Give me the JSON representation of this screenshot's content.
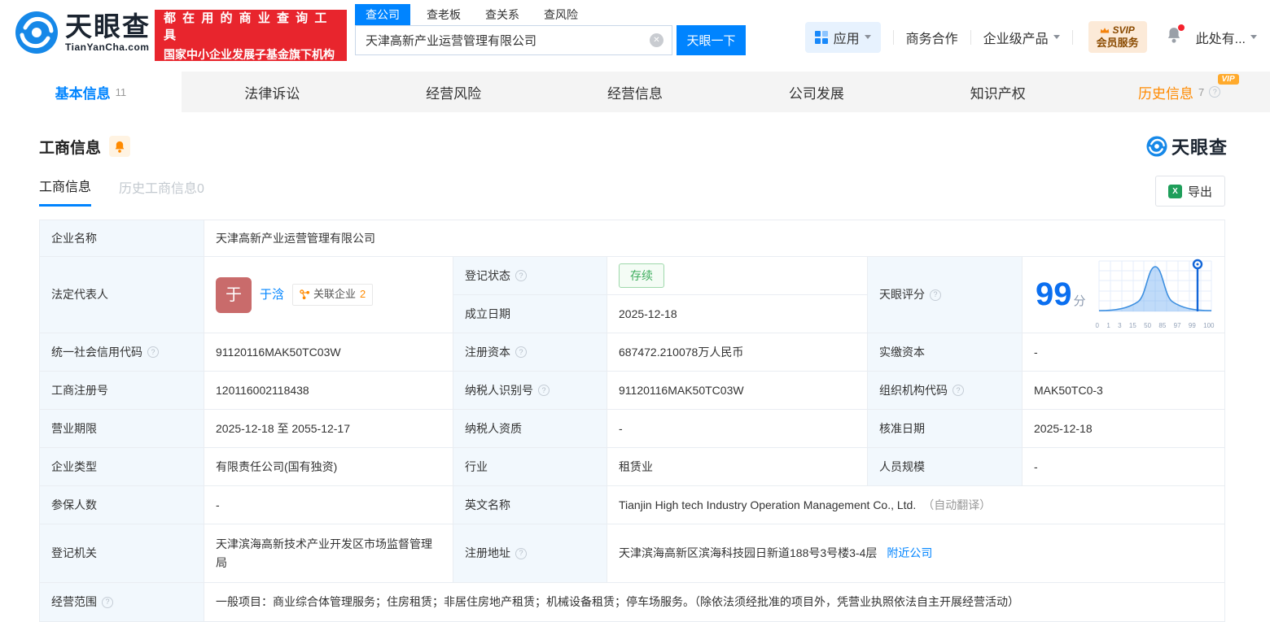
{
  "header": {
    "logo": {
      "brand": "天眼查",
      "domain": "TianYanCha.com"
    },
    "promo": {
      "line1": "都 在 用 的 商 业 查 询 工 具",
      "line2": "国家中小企业发展子基金旗下机构"
    },
    "search": {
      "tabs": [
        {
          "label": "查公司"
        },
        {
          "label": "查老板"
        },
        {
          "label": "查关系"
        },
        {
          "label": "查风险"
        }
      ],
      "value": "天津高新产业运营管理有限公司",
      "button": "天眼一下"
    },
    "nav": {
      "apps": "应用",
      "biz": "商务合作",
      "enterprise": "企业级产品",
      "svip": {
        "line1": "SVIP",
        "line2": "会员服务"
      },
      "user": "此处有..."
    }
  },
  "tabs": [
    {
      "label": "基本信息",
      "count": "11"
    },
    {
      "label": "法律诉讼"
    },
    {
      "label": "经营风险"
    },
    {
      "label": "经营信息"
    },
    {
      "label": "公司发展"
    },
    {
      "label": "知识产权"
    },
    {
      "label": "历史信息",
      "count": "7",
      "vip": "VIP"
    }
  ],
  "section": {
    "title": "工商信息",
    "watermark": "天眼查",
    "subtabs": [
      {
        "label": "工商信息"
      },
      {
        "label": "历史工商信息",
        "count": "0"
      }
    ],
    "export_label": "导出"
  },
  "fields": {
    "company_name": {
      "label": "企业名称",
      "value": "天津高新产业运营管理有限公司"
    },
    "legal_rep": {
      "label": "法定代表人",
      "avatar": "于",
      "name": "于浛",
      "badge": "关联企业",
      "badge_count": "2"
    },
    "reg_status": {
      "label": "登记状态",
      "value": "存续"
    },
    "est_date": {
      "label": "成立日期",
      "value": "2025-12-18"
    },
    "score": {
      "label": "天眼评分",
      "value": "99",
      "unit": "分",
      "axis": [
        "0",
        "1",
        "3",
        "15",
        "50",
        "85",
        "97",
        "99",
        "100"
      ]
    },
    "credit_code": {
      "label": "统一社会信用代码",
      "value": "91120116MAK50TC03W"
    },
    "reg_capital": {
      "label": "注册资本",
      "value": "687472.210078万人民币"
    },
    "paid_capital": {
      "label": "实缴资本",
      "value": "-"
    },
    "reg_number": {
      "label": "工商注册号",
      "value": "120116002118438"
    },
    "taxpayer_id": {
      "label": "纳税人识别号",
      "value": "91120116MAK50TC03W"
    },
    "org_code": {
      "label": "组织机构代码",
      "value": "MAK50TC0-3"
    },
    "biz_term": {
      "label": "营业期限",
      "value": "2025-12-18 至 2055-12-17"
    },
    "taxpayer_quality": {
      "label": "纳税人资质",
      "value": "-"
    },
    "approval_date": {
      "label": "核准日期",
      "value": "2025-12-18"
    },
    "company_type": {
      "label": "企业类型",
      "value": "有限责任公司(国有独资)"
    },
    "industry": {
      "label": "行业",
      "value": "租赁业"
    },
    "staff_size": {
      "label": "人员规模",
      "value": "-"
    },
    "insured_count": {
      "label": "参保人数",
      "value": "-"
    },
    "english_name": {
      "label": "英文名称",
      "value": "Tianjin High tech Industry Operation Management Co., Ltd.",
      "note": "（自动翻译）"
    },
    "reg_authority": {
      "label": "登记机关",
      "value": "天津滨海高新技术产业开发区市场监督管理局"
    },
    "reg_address": {
      "label": "注册地址",
      "value": "天津滨海高新区滨海科技园日新道188号3号楼3-4层",
      "link": "附近公司"
    },
    "business_scope": {
      "label": "经营范围",
      "value": "一般项目：商业综合体管理服务；住房租赁；非居住房地产租赁；机械设备租赁；停车场服务。（除依法须经批准的项目外，凭营业执照依法自主开展经营活动）"
    }
  },
  "colors": {
    "primary": "#0084ff",
    "promo_red": "#e8252d",
    "orange": "#ff8a00",
    "status_green": "#3fae5e"
  }
}
